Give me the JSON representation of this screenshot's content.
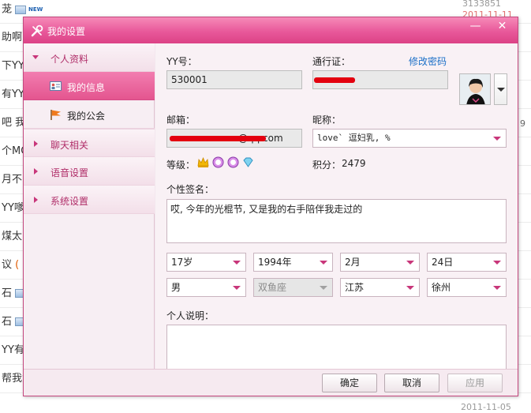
{
  "background": {
    "rows": [
      {
        "text": "茏",
        "icon": "image-icon",
        "badge": "NEW"
      },
      {
        "text": "助啊"
      },
      {
        "text": "下YY"
      },
      {
        "text": "有YY"
      },
      {
        "text": "吧 我"
      },
      {
        "text": "个MC"
      },
      {
        "text": "月不"
      },
      {
        "text": "YY嗲"
      },
      {
        "text": "煤太"
      },
      {
        "text": "议",
        "paren": "("
      },
      {
        "text": "石",
        "icon": "image-icon"
      },
      {
        "text": "石",
        "icon": "image-icon"
      },
      {
        "text": "YY有钱"
      },
      {
        "text": "帮我免费弄YY月票进"
      }
    ],
    "top_number": "3133851",
    "top_date": "2011-11-11",
    "bottom_date": "2011-11-05",
    "side_digit": "9"
  },
  "dialog": {
    "title": "我的设置",
    "window_buttons": {
      "minimize": "—",
      "close": "✕"
    },
    "sidebar": [
      {
        "label": "个人资料",
        "expanded": true
      },
      {
        "label": "我的信息",
        "active": true,
        "icon": "id-card-icon"
      },
      {
        "label": "我的公会",
        "icon": "flag-icon"
      },
      {
        "label": "聊天相关"
      },
      {
        "label": "语音设置"
      },
      {
        "label": "系统设置"
      }
    ],
    "form": {
      "yy_label": "YY号：",
      "yy_value": "530001",
      "passport_label": "通行证：",
      "passport_value": "",
      "change_password": "修改密码",
      "email_label": "邮箱：",
      "email_value": "@qq.com",
      "nickname_label": "昵称：",
      "nickname_value": "love`        逗妇乳, %",
      "level_label": "等级：",
      "points_label": "积分：",
      "points_value": "2479",
      "signature_label": "个性签名：",
      "signature_value": "哎, 今年的光棍节, 又是我的右手陪伴我走过的",
      "age": "17岁",
      "year": "1994年",
      "month": "2月",
      "day": "24日",
      "gender": "男",
      "zodiac": "双鱼座",
      "province": "江苏",
      "city": "徐州",
      "intro_label": "个人说明：",
      "intro_value": ""
    },
    "buttons": {
      "ok": "确定",
      "cancel": "取消",
      "apply": "应用"
    }
  },
  "colors": {
    "accent": "#e8589a",
    "link": "#1a6fc7",
    "redaction": "#e3000f"
  }
}
